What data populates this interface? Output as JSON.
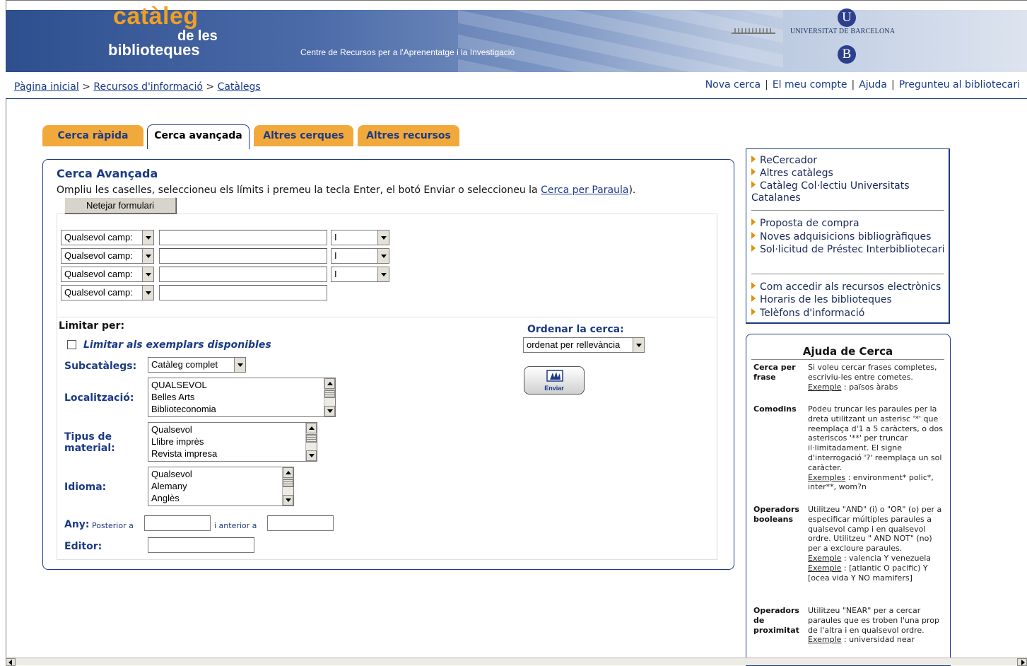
{
  "banner": {
    "logo_line1": "catàleg",
    "logo_line2": "de les",
    "logo_line3": "biblioteques",
    "subtitle": "Centre de Recursos per a l'Aprenentatge i la Investigació",
    "university": "UNIVERSITAT DE BARCELONA",
    "ub_top": "U",
    "ub_bottom": "B"
  },
  "breadcrumb": {
    "home": "Pàgina inicial",
    "resources": "Recursos d'informació",
    "catalogs": "Catàlegs",
    "sep": ">"
  },
  "toplinks": {
    "new_search": "Nova cerca",
    "my_account": "El meu compte",
    "help": "Ajuda",
    "ask": "Pregunteu al bibliotecari",
    "sep": "|"
  },
  "tabs": [
    "Cerca ràpida",
    "Cerca avançada",
    "Altres cerques",
    "Altres recursos"
  ],
  "form": {
    "title": "Cerca Avançada",
    "instructions_pre": "Ompliu les caselles, seleccioneu els límits i premeu la tecla Enter, el botó Enviar o seleccioneu la ",
    "instructions_link": "Cerca per Paraula",
    "instructions_post": ").",
    "clear_button": "Netejar formulari",
    "field_select": "Qualsevol camp:",
    "operator_select": "I",
    "limit_by": "Limitar per:",
    "limit_available": "Limitar als exemplars disponibles",
    "subcatalogs_label": "Subcatàlegs:",
    "subcatalogs_value": "Catàleg complet",
    "location_label": "Localització:",
    "location_options": [
      "QUALSEVOL",
      "Belles Arts",
      "Biblioteconomia"
    ],
    "material_label_1": "Tipus de",
    "material_label_2": "material:",
    "material_options": [
      "Qualsevol",
      "Llibre imprès",
      "Revista impresa"
    ],
    "language_label": "Idioma:",
    "language_options": [
      "Qualsevol",
      "Alemany",
      "Anglès"
    ],
    "year_label": "Any:",
    "year_after": "Posterior a",
    "year_before": "i anterior a",
    "publisher_label": "Editor:",
    "sort_label": "Ordenar la cerca:",
    "sort_value": "ordenat per rellevància",
    "send_button": "Enviar"
  },
  "sidebar": {
    "group1": [
      "ReCercador",
      "Altres catàlegs",
      "Catàleg Col·lectiu Universitats Catalanes"
    ],
    "group2": [
      "Proposta de compra",
      "Noves adquisicions bibliogràfiques",
      "Sol·licitud de Préstec Interbibliotecari"
    ],
    "group3": [
      "Com accedir als recursos electrònics",
      "Horaris de les biblioteques",
      "Telèfons d'informació"
    ]
  },
  "help": {
    "title": "Ajuda de Cerca",
    "sections": [
      {
        "term": "Cerca per frase",
        "text": "Si voleu cercar frases completes, escriviu-les entre cometes.",
        "ex_label": "Exemple",
        "ex": " : països àrabs"
      },
      {
        "term": "Comodins",
        "text": "Podeu truncar les paraules per la dreta utilitzant un asterisc '*' que reemplaça d'1 a 5 caràcters, o dos asteriscos '**' per truncar il·limitadament. El signe d'interrogació '?' reemplaça un sol caràcter.",
        "ex_label": "Exemples",
        "ex": " : environment* polic*, inter**, wom?n"
      },
      {
        "term": "Operadors booleans",
        "text": "Utilitzeu \"AND\" (i) o \"OR\" (o) per a especificar múltiples paraules a qualsevol camp i en qualsevol ordre. Utilitzeu \" AND NOT\" (no) per a excloure paraules.",
        "ex_label": "Exemple",
        "ex": " : valencia Y venezuela",
        "ex2": " : [atlantic O pacific) Y [ocea vida Y NO mamifers]"
      },
      {
        "term": "Operadors de proximitat",
        "text": "Utilitzeu \"NEAR\" per a cercar paraules que es troben l'una prop de l'altra i en qualsevol ordre.",
        "ex_label": "Exemple",
        "ex": " : universidad near"
      }
    ]
  },
  "colors": {
    "brand_blue": "#1c3a84",
    "tab_orange": "#f2a93b",
    "logo_orange": "#f0a020"
  }
}
